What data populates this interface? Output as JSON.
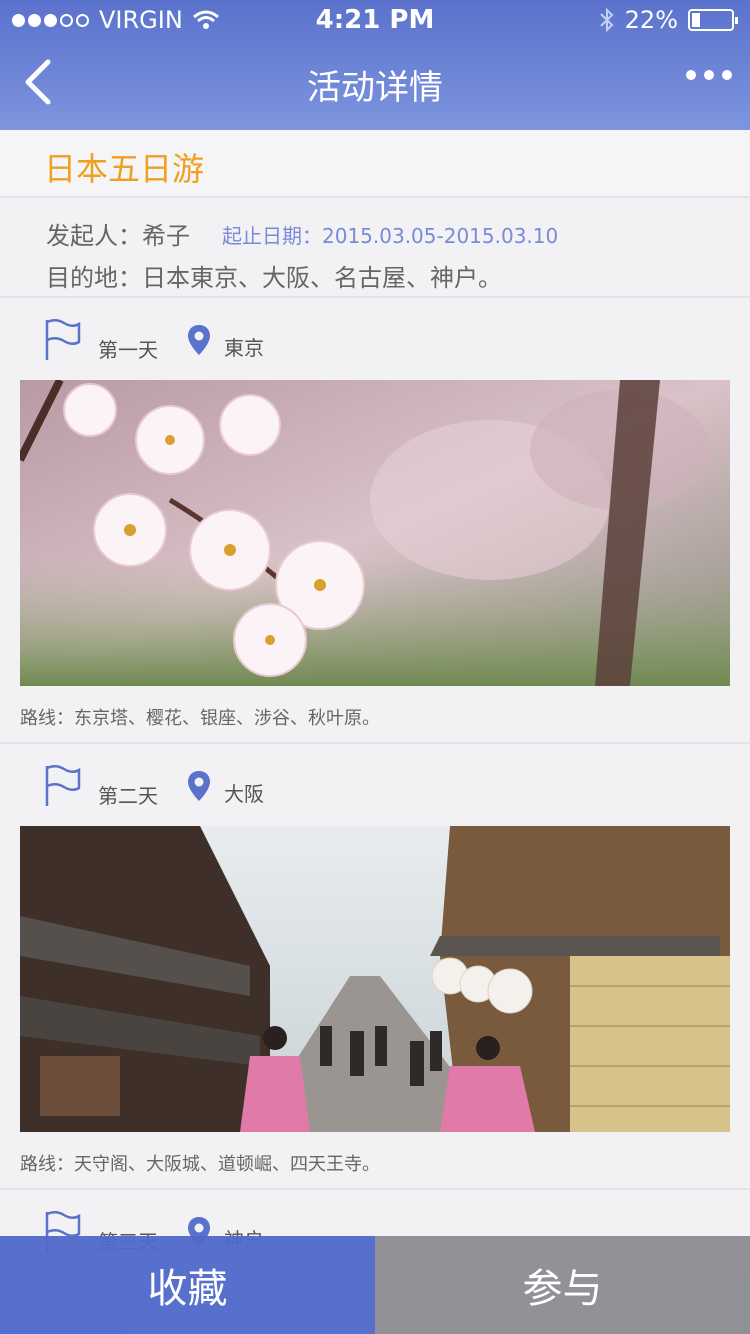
{
  "status_bar": {
    "carrier": "VIRGIN",
    "time": "4:21 PM",
    "battery": "22%",
    "battery_level": 0.22
  },
  "nav": {
    "title": "活动详情"
  },
  "trip": {
    "title": "日本五日游",
    "organizer": "发起人：希子",
    "dates": "起止日期：2015.03.05-2015.03.10",
    "destination": "目的地：日本東京、大阪、名古屋、神户。"
  },
  "days": [
    {
      "label": "第一天",
      "city": "東京",
      "route": "路线：东京塔、樱花、银座、涉谷、秋叶原。"
    },
    {
      "label": "第二天",
      "city": "大阪",
      "route": "路线：天守阁、大阪城、道顿崛、四天王寺。"
    },
    {
      "label": "第三天",
      "city": "神户"
    }
  ],
  "bottom_bar": {
    "favorite": "收藏",
    "join": "参与"
  },
  "colors": {
    "header": "#5a72cc",
    "accent_title": "#f0a020",
    "date_text": "#7a8bd6",
    "favorite_button": "#506acc",
    "join_button": "#78787f"
  },
  "icons": [
    "back-chevron-icon",
    "more-dots-icon",
    "flag-icon",
    "location-pin-icon",
    "wifi-icon",
    "bluetooth-icon",
    "battery-icon"
  ]
}
